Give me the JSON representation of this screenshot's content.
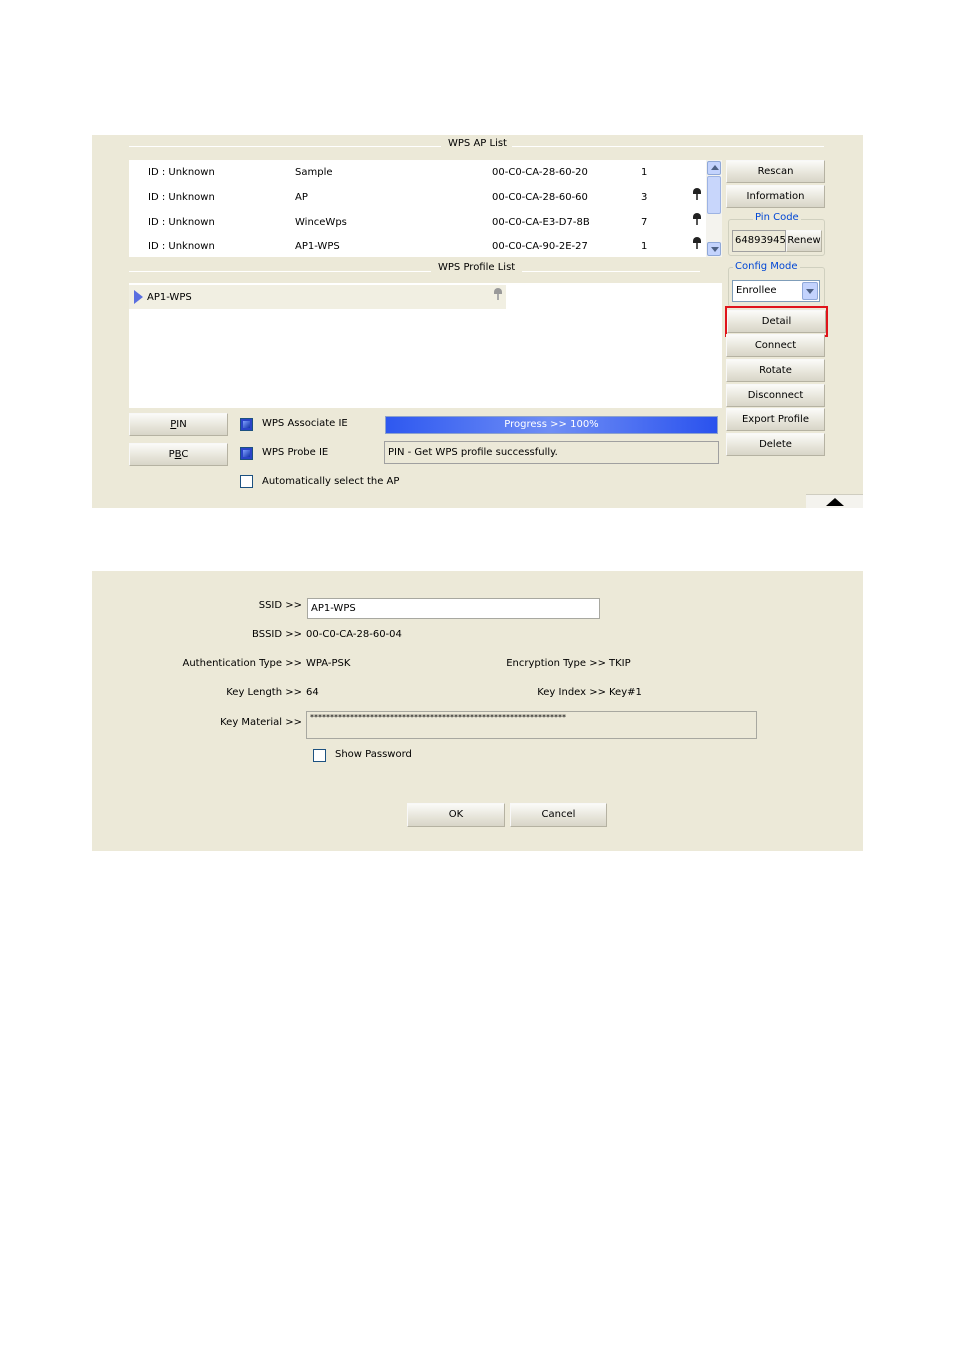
{
  "wps": {
    "ap_list_title": "WPS AP List",
    "ap_rows": [
      {
        "id": "ID : Unknown",
        "ssid": "Sample",
        "bssid": "00-C0-CA-28-60-20",
        "channel": "1",
        "secured": false
      },
      {
        "id": "ID : Unknown",
        "ssid": "AP",
        "bssid": "00-C0-CA-28-60-60",
        "channel": "3",
        "secured": true
      },
      {
        "id": "ID : Unknown",
        "ssid": "WinceWps",
        "bssid": "00-C0-CA-E3-D7-8B",
        "channel": "7",
        "secured": true
      },
      {
        "id": "ID : Unknown",
        "ssid": "AP1-WPS",
        "bssid": "00-C0-CA-90-2E-27",
        "channel": "1",
        "secured": true
      }
    ],
    "profile_list_title": "WPS Profile List",
    "profile_items": [
      {
        "name": "AP1-WPS",
        "secured": true
      }
    ],
    "buttons": {
      "rescan": "Rescan",
      "information": "Information",
      "renew": "Renew",
      "detail": "Detail",
      "connect": "Connect",
      "rotate": "Rotate",
      "disconnect": "Disconnect",
      "export_profile": "Export Profile",
      "delete": "Delete",
      "pin_prefix": "",
      "pin_access": "P",
      "pin_rest": "IN",
      "pbc_pre": "P",
      "pbc_access": "B",
      "pbc_rest": "C"
    },
    "pin_code": {
      "legend": "Pin Code",
      "value": "64893945"
    },
    "config_mode": {
      "legend": "Config Mode",
      "selected": "Enrollee"
    },
    "checkboxes": {
      "associate_ie": {
        "label": "WPS Associate IE",
        "checked": true
      },
      "probe_ie": {
        "label": "WPS Probe IE",
        "checked": true
      },
      "auto_select": {
        "label": "Automatically select the AP",
        "checked": false
      }
    },
    "progress": {
      "text": "Progress >> 100%",
      "value": 100
    },
    "status_text": "PIN - Get WPS profile successfully.",
    "highlight_color": "#e0141b"
  },
  "detail": {
    "ssid_label": "SSID >>",
    "ssid_value": "AP1-WPS",
    "bssid_label": "BSSID >>",
    "bssid_value": "00-C0-CA-28-60-04",
    "auth_label": "Authentication Type >>",
    "auth_value": "WPA-PSK",
    "enc_label": "Encryption Type >>",
    "enc_value": "TKIP",
    "key_length_label": "Key Length >>",
    "key_length_value": "64",
    "key_index_label": "Key Index >>",
    "key_index_value": "Key#1",
    "key_material_label": "Key Material >>",
    "key_material_value": "****************************************************************",
    "show_password_label": "Show Password",
    "ok": "OK",
    "cancel": "Cancel"
  }
}
